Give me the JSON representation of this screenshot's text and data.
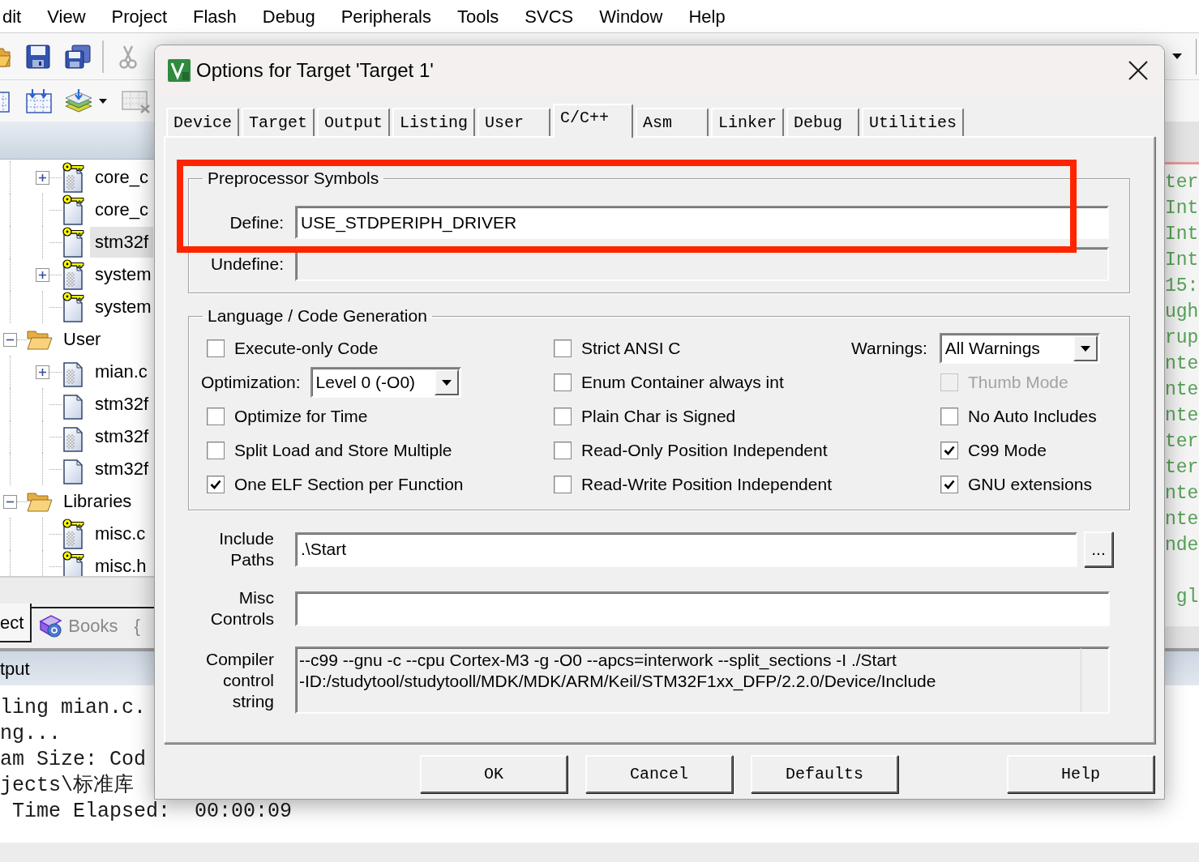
{
  "menu_bar": {
    "items": [
      "dit",
      "View",
      "Project",
      "Flash",
      "Debug",
      "Peripherals",
      "Tools",
      "SVCS",
      "Window",
      "Help"
    ]
  },
  "project_tree": {
    "items": [
      {
        "children": [
          {
            "label": "core_c",
            "kind": "source",
            "key": true,
            "expanded": false,
            "selected": false
          },
          {
            "label": "core_c",
            "kind": "header",
            "key": true,
            "selected": false
          },
          {
            "label": "stm32f",
            "kind": "header",
            "key": true,
            "selected": true
          },
          {
            "label": "system",
            "kind": "source",
            "key": true,
            "expanded": false,
            "selected": false
          },
          {
            "label": "system",
            "kind": "header",
            "key": true,
            "selected": false
          }
        ]
      },
      {
        "label": "User",
        "kind": "folder",
        "expanded": true,
        "selected": false,
        "children": [
          {
            "label": "mian.c",
            "kind": "source",
            "key": false,
            "expanded": false,
            "selected": false
          },
          {
            "label": "stm32f",
            "kind": "header",
            "key": false,
            "selected": false
          },
          {
            "label": "stm32f",
            "kind": "source",
            "key": false,
            "selected": false
          },
          {
            "label": "stm32f",
            "kind": "header",
            "key": false,
            "selected": false
          }
        ]
      },
      {
        "label": "Libraries",
        "kind": "folder",
        "expanded": true,
        "selected": false,
        "children": [
          {
            "label": "misc.c",
            "kind": "source",
            "key": true,
            "selected": false
          },
          {
            "label": "misc.h",
            "kind": "header",
            "key": true,
            "selected": false
          }
        ]
      }
    ]
  },
  "project_tabs": [
    {
      "label": "ect",
      "selected": true,
      "icon": false
    },
    {
      "label": "Books",
      "selected": false,
      "icon": true
    },
    {
      "label": "{",
      "selected": false,
      "icon": false
    }
  ],
  "editor": {
    "blocks": [
      [
        "ter",
        "Int",
        "Int",
        "Int",
        "15:",
        "ugh",
        "rup",
        "nte",
        "nte",
        "nte",
        "ter",
        "ter",
        "nte",
        "nte",
        "nde"
      ],
      [
        " gl"
      ]
    ]
  },
  "output": {
    "title": "tput",
    "lines": [
      "ling mian.c.",
      "ng...",
      "am Size: Cod",
      "jects\\标准库",
      " Time Elapsed:  00:00:09"
    ]
  },
  "dialog": {
    "title": "Options for Target 'Target 1'",
    "tabs": [
      {
        "label": "Device",
        "selected": false
      },
      {
        "label": "Target",
        "selected": false
      },
      {
        "label": "Output",
        "selected": false
      },
      {
        "label": "Listing",
        "selected": false
      },
      {
        "label": "User",
        "selected": false
      },
      {
        "label": "C/C++",
        "selected": true
      },
      {
        "label": "Asm",
        "selected": false
      },
      {
        "label": "Linker",
        "selected": false
      },
      {
        "label": "Debug",
        "selected": false
      },
      {
        "label": "Utilities",
        "selected": false
      }
    ],
    "preprocessor": {
      "title": "Preprocessor Symbols",
      "fields": [
        {
          "label": "Define:",
          "value": "USE_STDPERIPH_DRIVER",
          "read_only": false
        },
        {
          "label": "Undefine:",
          "read_only": true
        }
      ]
    },
    "code_generation": {
      "title": "Language / Code Generation",
      "columns": [
        [
          {
            "kind": "checkbox",
            "label": "Execute-only Code",
            "checked": false,
            "disabled": false
          },
          {
            "kind": "select",
            "label": "Optimization:",
            "value": "Level 0 (-O0)"
          },
          {
            "kind": "checkbox",
            "label": "Optimize for Time",
            "checked": false,
            "disabled": false
          },
          {
            "kind": "checkbox",
            "label": "Split Load and Store Multiple",
            "checked": false,
            "disabled": false
          },
          {
            "kind": "checkbox",
            "label": "One ELF Section per Function",
            "checked": true,
            "disabled": false
          }
        ],
        [
          {
            "kind": "checkbox",
            "label": "Strict ANSI C",
            "checked": false,
            "disabled": false
          },
          {
            "kind": "checkbox",
            "label": "Enum Container always int",
            "checked": false,
            "disabled": false
          },
          {
            "kind": "checkbox",
            "label": "Plain Char is Signed",
            "checked": false,
            "disabled": false
          },
          {
            "kind": "checkbox",
            "label": "Read-Only Position Independent",
            "checked": false,
            "disabled": false
          },
          {
            "kind": "checkbox",
            "label": "Read-Write Position Independent",
            "checked": false,
            "disabled": false
          }
        ],
        [
          {
            "kind": "select",
            "label": "Warnings:",
            "value": "All Warnings"
          },
          {
            "kind": "checkbox",
            "label": "Thumb Mode",
            "checked": false,
            "disabled": true
          },
          {
            "kind": "checkbox",
            "label": "No Auto Includes",
            "checked": false,
            "disabled": false
          },
          {
            "kind": "checkbox",
            "label": "C99 Mode",
            "checked": true,
            "disabled": false
          },
          {
            "kind": "checkbox",
            "label": "GNU extensions",
            "checked": true,
            "disabled": false
          }
        ]
      ]
    },
    "compiler_fields": [
      {
        "kind": "input",
        "label": "Include Paths",
        "value": ".\\Start",
        "read_only": false,
        "button": "..."
      },
      {
        "kind": "input",
        "label": "Misc Controls",
        "read_only": false
      },
      {
        "kind": "textarea",
        "label": "Compiler control string",
        "read_only": true,
        "lines": [
          "--c99 --gnu -c --cpu Cortex-M3 -g -O0 --apcs=interwork --split_sections -I ./Start",
          "-ID:/studytool/studytooll/MDK/MDK/ARM/Keil/STM32F1xx_DFP/2.2.0/Device/Include"
        ]
      }
    ],
    "buttons": [
      "OK",
      "Cancel",
      "Defaults",
      "Help"
    ]
  },
  "annotations": [
    {
      "kind": "highlight_box"
    }
  ]
}
